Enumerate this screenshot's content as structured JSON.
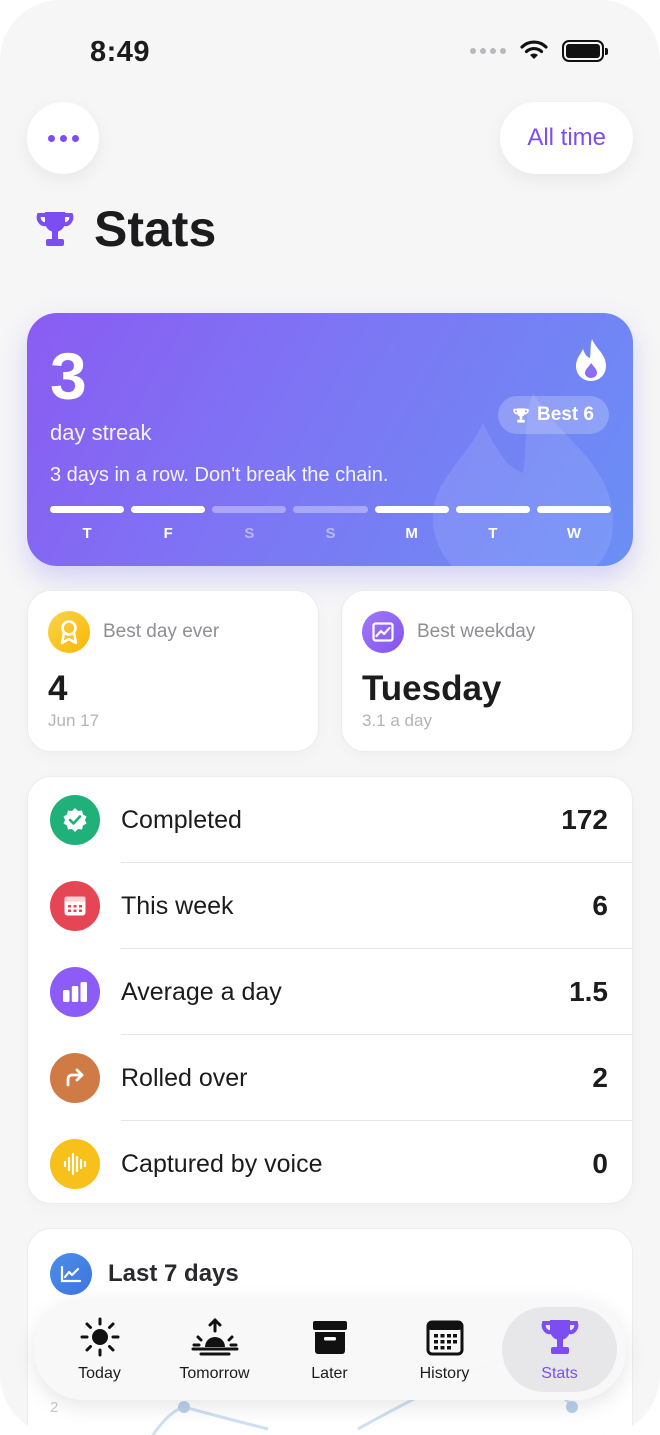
{
  "status_bar": {
    "time": "8:49"
  },
  "header": {
    "range_label": "All time",
    "title": "Stats"
  },
  "streak": {
    "count": "3",
    "unit": "day streak",
    "message": "3 days in a row. Don't break the chain.",
    "best_label": "Best 6",
    "days": [
      {
        "label": "T",
        "done": true
      },
      {
        "label": "F",
        "done": true
      },
      {
        "label": "S",
        "done": false
      },
      {
        "label": "S",
        "done": false
      },
      {
        "label": "M",
        "done": true
      },
      {
        "label": "T",
        "done": true
      },
      {
        "label": "W",
        "done": true
      }
    ]
  },
  "best_day": {
    "label": "Best day ever",
    "value": "4",
    "sub": "Jun 17"
  },
  "best_weekday": {
    "label": "Best weekday",
    "value": "Tuesday",
    "sub": "3.1 a day"
  },
  "stats": [
    {
      "name": "Completed",
      "value": "172",
      "icon": "check-badge-icon",
      "color": "#20b07a"
    },
    {
      "name": "This week",
      "value": "6",
      "icon": "calendar-icon",
      "color": "#e64553"
    },
    {
      "name": "Average a day",
      "value": "1.5",
      "icon": "bar-chart-icon",
      "color": "#8d5cf6"
    },
    {
      "name": "Rolled over",
      "value": "2",
      "icon": "rollover-arrow-icon",
      "color": "#d07a45"
    },
    {
      "name": "Captured by voice",
      "value": "0",
      "icon": "waveform-icon",
      "color": "#f8c01a"
    }
  ],
  "last7": {
    "title": "Last 7 days",
    "axis_label": "2"
  },
  "tabs": [
    {
      "label": "Today",
      "icon": "sun-icon"
    },
    {
      "label": "Tomorrow",
      "icon": "sunrise-icon"
    },
    {
      "label": "Later",
      "icon": "archive-box-icon"
    },
    {
      "label": "History",
      "icon": "calendar-grid-icon"
    },
    {
      "label": "Stats",
      "icon": "trophy-icon",
      "active": true
    }
  ],
  "colors": {
    "accent": "#7b4df2",
    "streak_start": "#8a5cf2",
    "streak_end": "#6a8ff5"
  }
}
